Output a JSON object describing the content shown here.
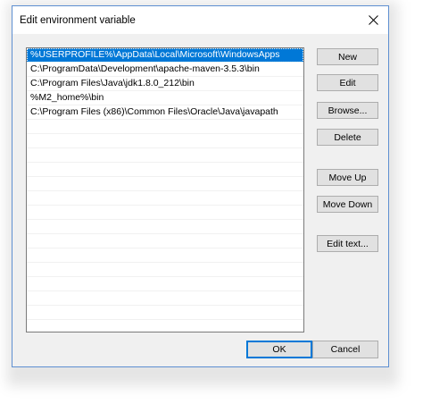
{
  "window": {
    "title": "Edit environment variable",
    "close_icon": "close-icon"
  },
  "list": {
    "items": [
      "%USERPROFILE%\\AppData\\Local\\Microsoft\\WindowsApps",
      "C:\\ProgramData\\Development\\apache-maven-3.5.3\\bin",
      "C:\\Program Files\\Java\\jdk1.8.0_212\\bin",
      "%M2_home%\\bin",
      "C:\\Program Files (x86)\\Common Files\\Oracle\\Java\\javapath"
    ],
    "selected_index": 0
  },
  "buttons": {
    "new": "New",
    "edit": "Edit",
    "browse": "Browse...",
    "delete": "Delete",
    "move_up": "Move Up",
    "move_down": "Move Down",
    "edit_text": "Edit text...",
    "ok": "OK",
    "cancel": "Cancel"
  },
  "colors": {
    "selection": "#0078d7",
    "dialog_border": "#5e8fd1",
    "dialog_background": "#f0f0f0"
  }
}
